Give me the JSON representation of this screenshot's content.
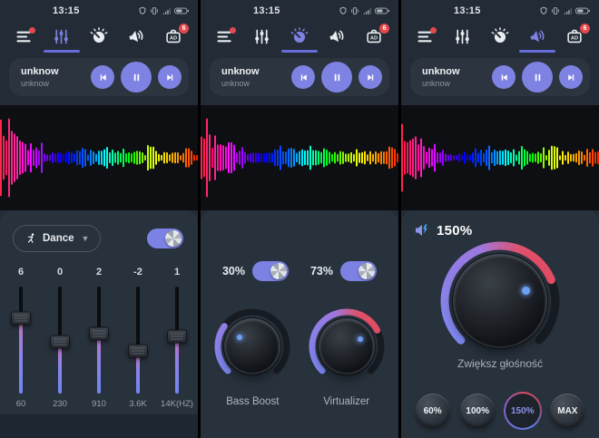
{
  "colors": {
    "accent": "#7d82e2",
    "badge": "#e5484d",
    "arc_blue": "#7d89f2",
    "arc_purple": "#9b79e0",
    "arc_red": "#e0485e",
    "slider_gradient_top": "#c76fb4",
    "slider_gradient_bottom": "#6d87f3"
  },
  "common": {
    "status": {
      "time": "13:15"
    },
    "status_icons": [
      "shield-icon",
      "vibrate-icon",
      "signal-icon",
      "battery-icon"
    ],
    "tabs": [
      "menu",
      "equalizer",
      "effects",
      "volume-booster",
      "ads"
    ],
    "ad_badge": "6",
    "player": {
      "title": "unknow",
      "subtitle": "unknow"
    }
  },
  "screens": [
    {
      "active_tab": "equalizer",
      "panel": {
        "preset_label": "Dance",
        "preset_icon": "dancer-icon",
        "eq_enabled": true,
        "sliders": [
          {
            "gain": "6",
            "freq": "60",
            "pos": 0.3
          },
          {
            "gain": "0",
            "freq": "230",
            "pos": 0.52
          },
          {
            "gain": "2",
            "freq": "910",
            "pos": 0.44
          },
          {
            "gain": "-2",
            "freq": "3.6K",
            "pos": 0.6
          },
          {
            "gain": "1",
            "freq": "14K(HZ)",
            "pos": 0.47
          }
        ]
      }
    },
    {
      "active_tab": "effects",
      "knobs": [
        {
          "label": "Bass Boost",
          "percent": 30,
          "percent_label": "30%",
          "enabled": true
        },
        {
          "label": "Virtualizer",
          "percent": 73,
          "percent_label": "73%",
          "enabled": true
        }
      ]
    },
    {
      "active_tab": "volume-booster",
      "volume": {
        "value_label": "150%",
        "fraction": 0.75,
        "caption": "Zwiększ głośność",
        "buttons": [
          {
            "label": "60%",
            "selected": false
          },
          {
            "label": "100%",
            "selected": false
          },
          {
            "label": "150%",
            "selected": true
          },
          {
            "label": "MAX",
            "selected": false
          }
        ]
      }
    }
  ]
}
